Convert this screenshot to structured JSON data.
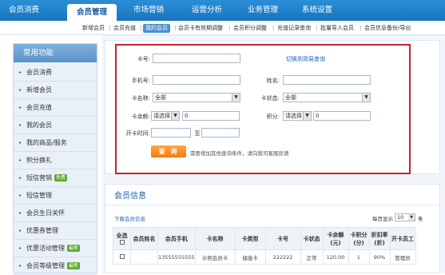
{
  "topnav": {
    "tabs": [
      {
        "label": "会员消费"
      },
      {
        "label": "会员管理"
      },
      {
        "label": "市场营销"
      },
      {
        "label": "运营分析"
      },
      {
        "label": "业务管理"
      },
      {
        "label": "系统设置"
      }
    ]
  },
  "subnav": {
    "items": [
      {
        "label": "新增会员"
      },
      {
        "label": "会员充值"
      },
      {
        "label": "我的会员"
      },
      {
        "label": "会员卡有效期调整"
      },
      {
        "label": "会员积分调整"
      },
      {
        "label": "充值记录查询"
      },
      {
        "label": "批量导入会员"
      },
      {
        "label": "会员信息备份/导出"
      }
    ]
  },
  "sidebar": {
    "title": "常用功能",
    "items": [
      {
        "label": "会员消费"
      },
      {
        "label": "新增会员"
      },
      {
        "label": "会员充值"
      },
      {
        "label": "我的会员"
      },
      {
        "label": "我的商品/服务"
      },
      {
        "label": "积分换礼"
      },
      {
        "label": "短信营销",
        "badge": "免费"
      },
      {
        "label": "短信管理"
      },
      {
        "label": "会员生日关怀"
      },
      {
        "label": "优惠券管理"
      },
      {
        "label": "优惠活动管理",
        "badge": "最新"
      },
      {
        "label": "会员等级管理",
        "badge": "最新"
      }
    ]
  },
  "search": {
    "card_no_label": "卡号:",
    "switch_link": "切换到简易查询",
    "phone_label": "手机号:",
    "name_label": "姓名:",
    "card_name_label": "卡名称:",
    "card_name_value": "全部",
    "card_status_label": "卡状态:",
    "card_status_value": "全部",
    "balance_label": "卡余额:",
    "balance_op": "请选择",
    "balance_value": "0",
    "points_label": "积分:",
    "points_op": "请选择",
    "points_value": "0",
    "open_time_label": "开卡时间:",
    "to_label": "至",
    "query_button": "查 询",
    "hint": "需要增加其他查询条件，请向我司客服反馈"
  },
  "info": {
    "title": "会员信息",
    "download": "下载会员信息",
    "per_page_label": "每页显示",
    "per_page_value": "10",
    "per_page_unit": "条",
    "columns": [
      "全选",
      "会员姓名",
      "会员手机",
      "卡名称",
      "卡类型",
      "卡号",
      "卡状态",
      "卡余额(元)",
      "卡积分(分)",
      "折扣率(折)",
      "开卡员工"
    ],
    "rows": [
      [
        "",
        "",
        "13555555555",
        "示例会员卡",
        "储值卡",
        "222222",
        "正常",
        "120.00",
        "1",
        "90%",
        "管理员"
      ]
    ]
  },
  "colors": {
    "nav_blue": "#1a74c0",
    "highlight_red": "#c8222c",
    "query_orange": "#f27a14",
    "badge_green": "#5aa832"
  }
}
